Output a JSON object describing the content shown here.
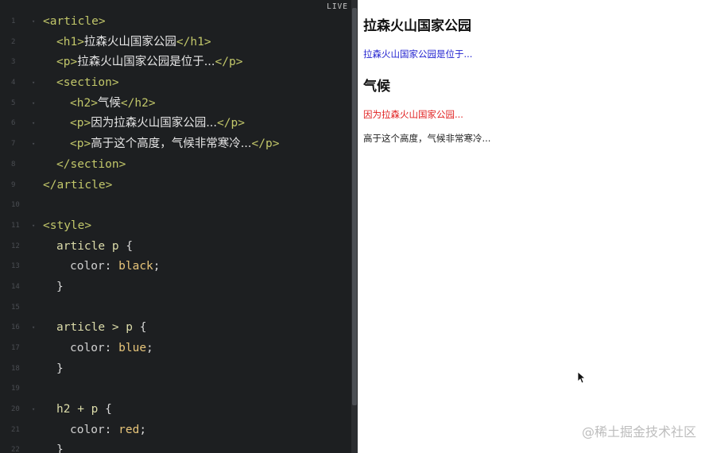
{
  "live_badge": "LIVE",
  "code_lines": [
    {
      "n": "1",
      "tokens": [
        {
          "c": "tag",
          "t": "<article>"
        }
      ],
      "ind": 0,
      "fold": true
    },
    {
      "n": "2",
      "tokens": [
        {
          "c": "tag",
          "t": "<h1>"
        },
        {
          "c": "cjk",
          "t": "拉森火山国家公园"
        },
        {
          "c": "tag",
          "t": "</h1>"
        }
      ],
      "ind": 1,
      "fold": false
    },
    {
      "n": "3",
      "tokens": [
        {
          "c": "tag",
          "t": "<p>"
        },
        {
          "c": "cjk",
          "t": "拉森火山国家公园是位于..."
        },
        {
          "c": "tag",
          "t": "</p>"
        }
      ],
      "ind": 1,
      "fold": false
    },
    {
      "n": "4",
      "tokens": [
        {
          "c": "tag",
          "t": "<section>"
        }
      ],
      "ind": 1,
      "fold": true
    },
    {
      "n": "5",
      "tokens": [
        {
          "c": "tag",
          "t": "<h2>"
        },
        {
          "c": "cjk",
          "t": "气候"
        },
        {
          "c": "tag",
          "t": "</h2>"
        }
      ],
      "ind": 2,
      "fold": true
    },
    {
      "n": "6",
      "tokens": [
        {
          "c": "tag",
          "t": "<p>"
        },
        {
          "c": "cjk",
          "t": "因为拉森火山国家公园..."
        },
        {
          "c": "tag",
          "t": "</p>"
        }
      ],
      "ind": 2,
      "fold": true
    },
    {
      "n": "7",
      "tokens": [
        {
          "c": "tag",
          "t": "<p>"
        },
        {
          "c": "cjk",
          "t": "高于这个高度，气候非常寒冷..."
        },
        {
          "c": "tag",
          "t": "</p>"
        }
      ],
      "ind": 2,
      "fold": true
    },
    {
      "n": "8",
      "tokens": [
        {
          "c": "tag",
          "t": "</section>"
        }
      ],
      "ind": 1,
      "fold": false
    },
    {
      "n": "9",
      "tokens": [
        {
          "c": "tag",
          "t": "</article>"
        }
      ],
      "ind": 0,
      "fold": false
    },
    {
      "n": "10",
      "tokens": [],
      "ind": 0,
      "fold": false
    },
    {
      "n": "11",
      "tokens": [
        {
          "c": "tag",
          "t": "<style>"
        }
      ],
      "ind": 0,
      "fold": true
    },
    {
      "n": "12",
      "tokens": [
        {
          "c": "sel",
          "t": "article p "
        },
        {
          "c": "punc",
          "t": "{"
        }
      ],
      "ind": 1,
      "fold": false
    },
    {
      "n": "13",
      "tokens": [
        {
          "c": "prop",
          "t": "color"
        },
        {
          "c": "punc",
          "t": ": "
        },
        {
          "c": "val",
          "t": "black"
        },
        {
          "c": "punc",
          "t": ";"
        }
      ],
      "ind": 2,
      "fold": false
    },
    {
      "n": "14",
      "tokens": [
        {
          "c": "punc",
          "t": "}"
        }
      ],
      "ind": 1,
      "fold": false
    },
    {
      "n": "15",
      "tokens": [],
      "ind": 0,
      "fold": false
    },
    {
      "n": "16",
      "tokens": [
        {
          "c": "sel",
          "t": "article > p "
        },
        {
          "c": "punc",
          "t": "{"
        }
      ],
      "ind": 1,
      "fold": true
    },
    {
      "n": "17",
      "tokens": [
        {
          "c": "prop",
          "t": "color"
        },
        {
          "c": "punc",
          "t": ": "
        },
        {
          "c": "val",
          "t": "blue"
        },
        {
          "c": "punc",
          "t": ";"
        }
      ],
      "ind": 2,
      "fold": false
    },
    {
      "n": "18",
      "tokens": [
        {
          "c": "punc",
          "t": "}"
        }
      ],
      "ind": 1,
      "fold": false
    },
    {
      "n": "19",
      "tokens": [],
      "ind": 0,
      "fold": false
    },
    {
      "n": "20",
      "tokens": [
        {
          "c": "sel",
          "t": "h2 + p "
        },
        {
          "c": "punc",
          "t": "{"
        }
      ],
      "ind": 1,
      "fold": true
    },
    {
      "n": "21",
      "tokens": [
        {
          "c": "prop",
          "t": "color"
        },
        {
          "c": "punc",
          "t": ": "
        },
        {
          "c": "val",
          "t": "red"
        },
        {
          "c": "punc",
          "t": ";"
        }
      ],
      "ind": 2,
      "fold": false
    },
    {
      "n": "22",
      "tokens": [
        {
          "c": "punc",
          "t": "}"
        }
      ],
      "ind": 1,
      "fold": false
    }
  ],
  "preview": {
    "h1": "拉森火山国家公园",
    "p1": "拉森火山国家公园是位于...",
    "h2": "气候",
    "p2": "因为拉森火山国家公园...",
    "p3": "高于这个高度，气候非常寒冷..."
  },
  "watermark": "@稀土掘金技术社区",
  "colors": {
    "editor_bg": "#1d1f21",
    "tag": "#c2c76a",
    "p_blue": "#1f1fcf",
    "p_red": "#e01f1f"
  }
}
